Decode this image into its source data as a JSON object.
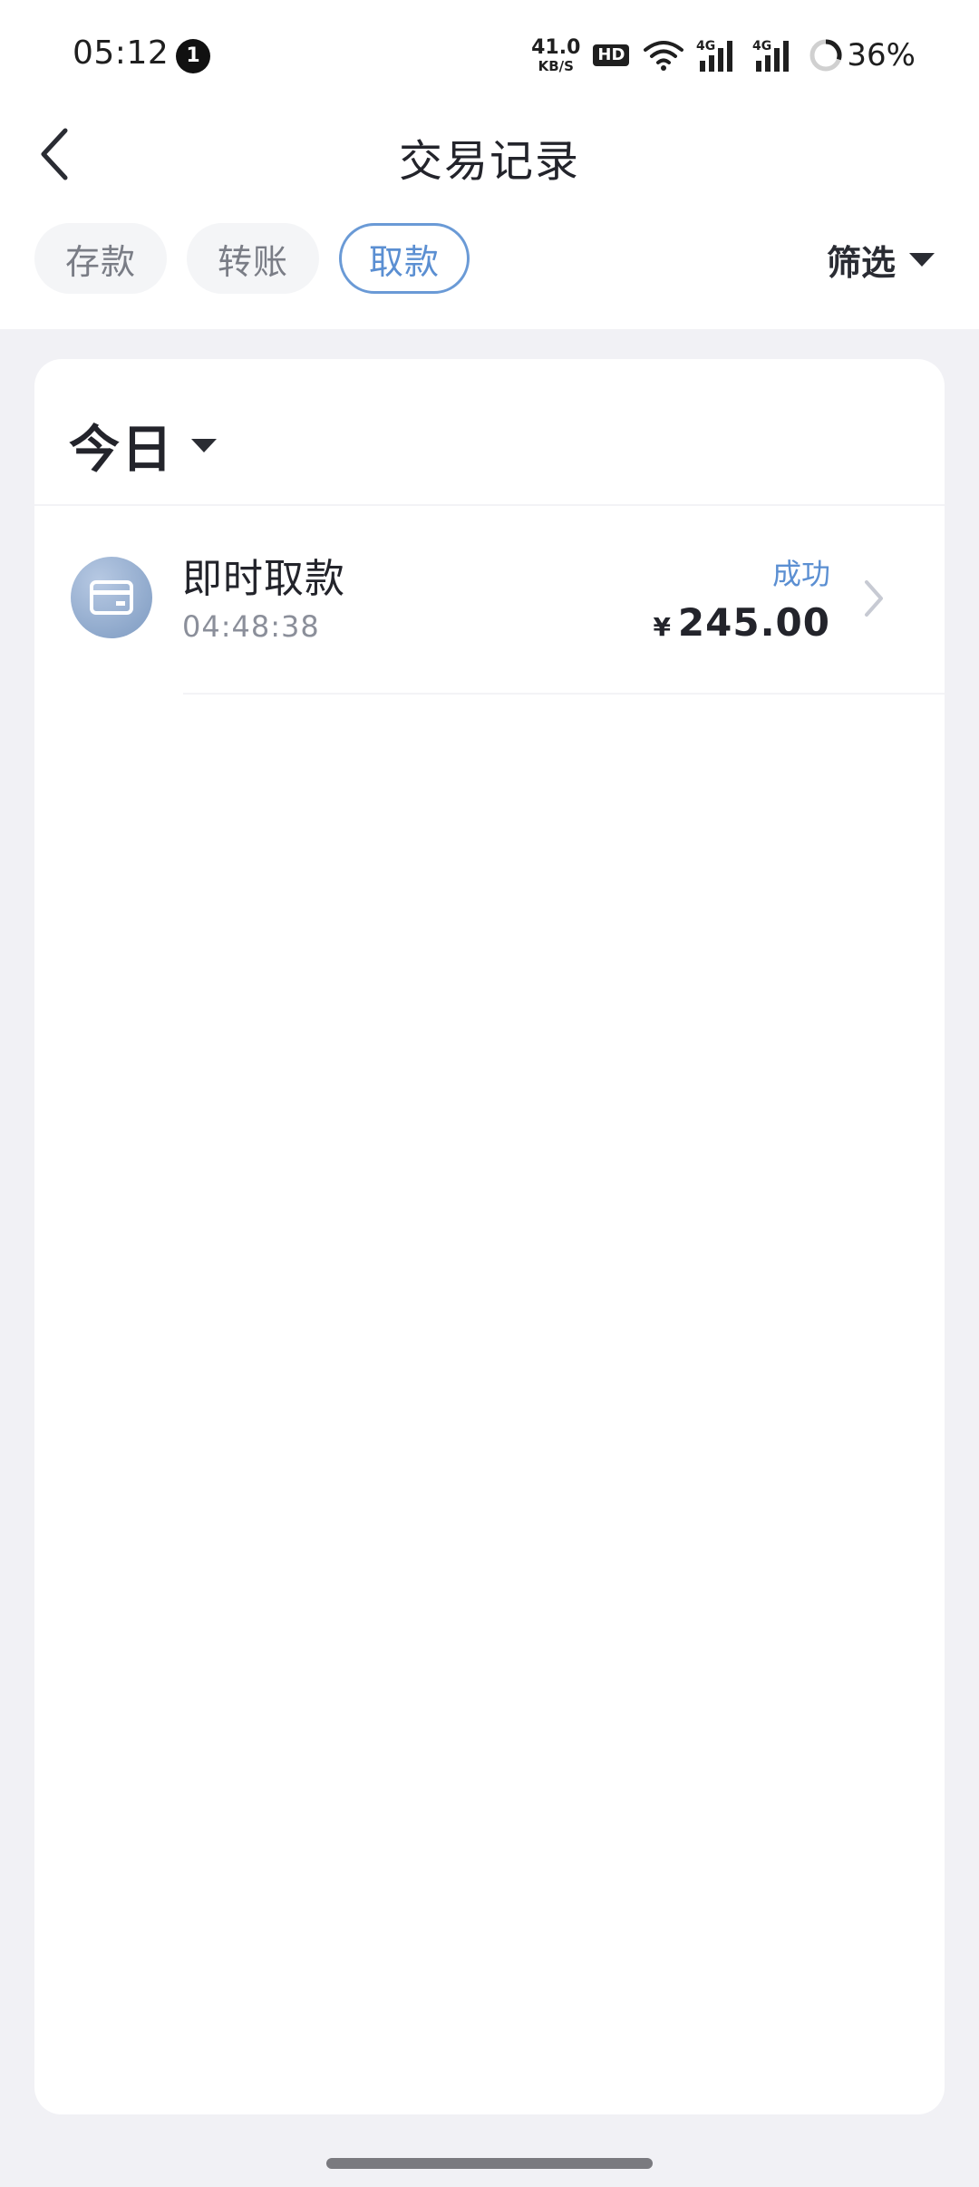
{
  "status_bar": {
    "time": "05:12",
    "notification_count": "1",
    "net_speed_value": "41.0",
    "net_speed_unit": "KB/S",
    "hd_label": "HD",
    "battery_percent": "36%",
    "icons": [
      "wifi-icon",
      "signal-4g-icon",
      "signal-4g-icon",
      "battery-ring-icon"
    ]
  },
  "header": {
    "title": "交易记录",
    "back_icon": "chevron-left-icon"
  },
  "tabs": [
    {
      "label": "存款",
      "active": false
    },
    {
      "label": "转账",
      "active": false
    },
    {
      "label": "取款",
      "active": true
    }
  ],
  "filter": {
    "label": "筛选",
    "icon": "caret-down-icon"
  },
  "card": {
    "date_label": "今日",
    "date_icon": "caret-down-icon",
    "records": [
      {
        "title": "即时取款",
        "time": "04:48:38",
        "status": "成功",
        "currency": "¥",
        "amount": "245.00",
        "icon": "card-icon"
      }
    ]
  },
  "colors": {
    "accent": "#5b8fd2",
    "background": "#f1f1f5",
    "text_primary": "#23242b",
    "text_secondary": "#8b8f9a"
  }
}
